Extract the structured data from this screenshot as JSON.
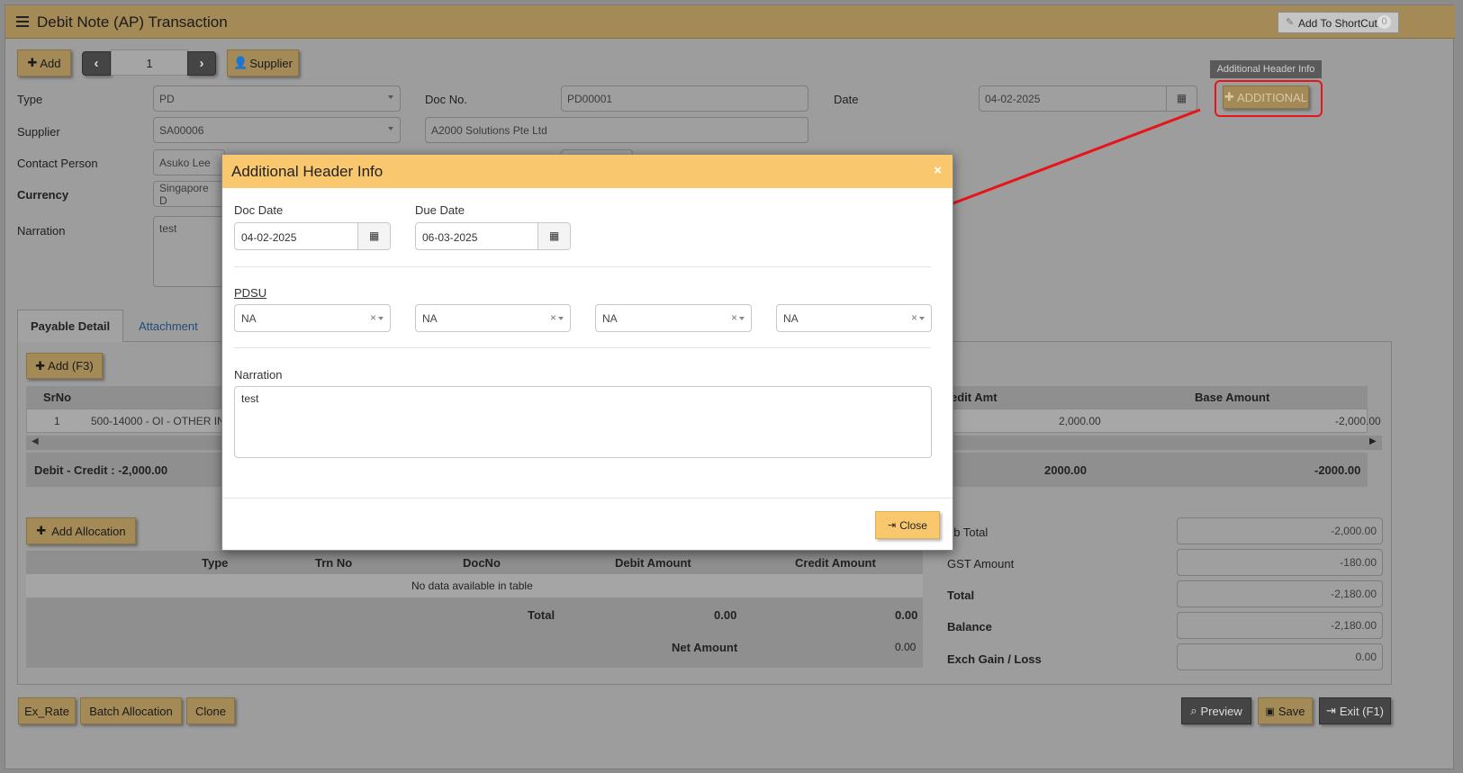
{
  "app": {
    "title": "Debit Note (AP) Transaction",
    "shortcut_label": "Add To ShortCut",
    "shortcut_count": "0"
  },
  "toolbar": {
    "add_label": "Add",
    "record_number": "1",
    "supplier_label": "Supplier"
  },
  "header": {
    "type_label": "Type",
    "type_value": "PD",
    "docno_label": "Doc No.",
    "docno_value": "PD00001",
    "date_label": "Date",
    "date_value": "04-02-2025",
    "supplier_label": "Supplier",
    "supplier_value": "SA00006",
    "supplier_name": "A2000 Solutions Pte Ltd",
    "contact_label": "Contact Person",
    "contact_value": "Asuko Lee",
    "currency_label": "Currency",
    "currency_value": "Singapore D",
    "narration_label": "Narration",
    "narration_value": "test",
    "tooltip": "Additional Header Info",
    "additional_label": "ADDITIONAL"
  },
  "tabs": [
    {
      "label": "Payable Detail"
    },
    {
      "label": "Attachment"
    }
  ],
  "detail": {
    "add_label": "Add (F3)",
    "col_srno": "SrNo",
    "col_credit": "edit Amt",
    "col_base": "Base Amount",
    "row_srno": "1",
    "row_account": "500-14000 - OI - OTHER IN",
    "row_credit": "2,000.00",
    "row_base": "-2,000.00",
    "footer_diff": "Debit - Credit : -2,000.00",
    "footer_credit": "2000.00",
    "footer_base": "-2000.00"
  },
  "allocation": {
    "add_label": "Add Allocation",
    "columns": [
      "Type",
      "Trn No",
      "DocNo",
      "Debit Amount",
      "Credit Amount"
    ],
    "empty_text": "No data available in table",
    "total_label": "Total",
    "total_debit": "0.00",
    "total_credit": "0.00",
    "net_label": "Net Amount",
    "net_value": "0.00"
  },
  "summary": {
    "subtotal_label": "ub Total",
    "subtotal_value": "-2,000.00",
    "gst_label": "GST Amount",
    "gst_value": "-180.00",
    "total_label": "Total",
    "total_value": "-2,180.00",
    "balance_label": "Balance",
    "balance_value": "-2,180.00",
    "exch_label": "Exch Gain / Loss",
    "exch_value": "0.00"
  },
  "footer_buttons": {
    "ex_rate": "Ex_Rate",
    "batch_allocation": "Batch Allocation",
    "clone": "Clone",
    "preview": "Preview",
    "save": "Save",
    "exit": "Exit (F1)"
  },
  "modal": {
    "title": "Additional Header Info",
    "close_x": "×",
    "doc_date_label": "Doc Date",
    "doc_date_value": "04-02-2025",
    "due_date_label": "Due Date",
    "due_date_value": "06-03-2025",
    "pdsu_label": "PDSU",
    "pdsu_values": [
      "NA",
      "NA",
      "NA",
      "NA"
    ],
    "narration_label": "Narration",
    "narration_value": "test",
    "close_label": "Close"
  },
  "colors": {
    "accent": "#f9c76e",
    "annotation": "#e8141a"
  }
}
